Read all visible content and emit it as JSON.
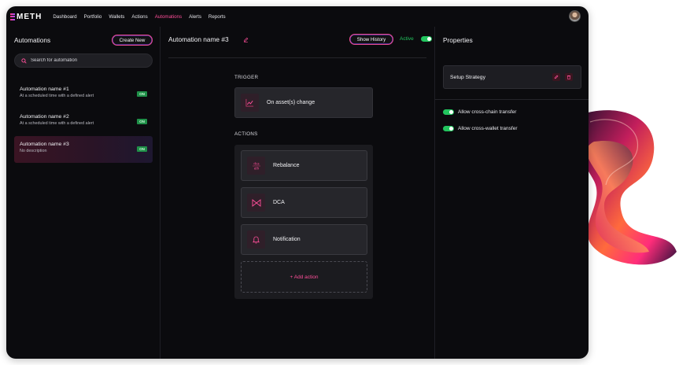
{
  "brand": {
    "name": "METH",
    "accent": "#ff4f9a"
  },
  "nav": {
    "items": [
      "Dashboard",
      "Portfolio",
      "Wallets",
      "Actions",
      "Automations",
      "Alerts",
      "Reports"
    ],
    "active": "Automations"
  },
  "left": {
    "title": "Automations",
    "create_label": "Create New",
    "search_placeholder": "Search for automation",
    "items": [
      {
        "name": "Automation name #1",
        "desc": "At a scheduled time with a defined alert",
        "badge": "ON"
      },
      {
        "name": "Automation name #2",
        "desc": "At a scheduled time with a defined alert",
        "badge": "ON"
      },
      {
        "name": "Automation name #3",
        "desc": "No description",
        "badge": "ON",
        "selected": true
      }
    ]
  },
  "center": {
    "title": "Automation name #3",
    "history_label": "Show History",
    "active_label": "Active",
    "trigger_label": "TRIGGER",
    "trigger_card": "On asset(s) change",
    "actions_label": "ACTIONS",
    "actions": [
      {
        "label": "Rebalance",
        "icon": "rebalance-icon"
      },
      {
        "label": "DCA",
        "icon": "dca-icon"
      },
      {
        "label": "Notification",
        "icon": "bell-icon"
      }
    ],
    "add_action": "+ Add action"
  },
  "right": {
    "title": "Properties",
    "strategy_label": "Setup Strategy",
    "options": [
      {
        "label": "Allow cross-chain transfer",
        "enabled": true
      },
      {
        "label": "Allow cross-wallet transfer",
        "enabled": true
      }
    ]
  },
  "colors": {
    "on": "#22c55e",
    "pink": "#ff4f9a",
    "purple": "#8a4dff",
    "bg": "#0b0b0e"
  }
}
